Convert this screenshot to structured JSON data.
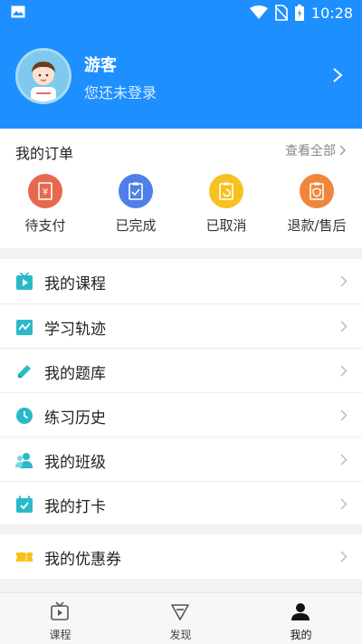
{
  "status_bar": {
    "time": "10:28"
  },
  "profile": {
    "name": "游客",
    "hint": "您还未登录"
  },
  "orders": {
    "title": "我的订单",
    "view_all": "查看全部",
    "items": [
      {
        "label": "待支付",
        "icon": "pending-payment-icon",
        "color": "#e8684e"
      },
      {
        "label": "已完成",
        "icon": "completed-icon",
        "color": "#4f7fe8"
      },
      {
        "label": "已取消",
        "icon": "cancelled-icon",
        "color": "#f7c21f"
      },
      {
        "label": "退款/售后",
        "icon": "refund-icon",
        "color": "#f0863c"
      }
    ]
  },
  "menu": [
    {
      "label": "我的课程",
      "icon": "course-play-icon"
    },
    {
      "label": "学习轨迹",
      "icon": "learning-track-icon"
    },
    {
      "label": "我的题库",
      "icon": "pencil-icon"
    },
    {
      "label": "练习历史",
      "icon": "clock-icon"
    },
    {
      "label": "我的班级",
      "icon": "class-people-icon"
    },
    {
      "label": "我的打卡",
      "icon": "checkin-calendar-icon"
    }
  ],
  "menu2": [
    {
      "label": "我的优惠券",
      "icon": "coupon-icon"
    }
  ],
  "tabs": [
    {
      "label": "课程",
      "icon": "tv-play-icon"
    },
    {
      "label": "发现",
      "icon": "discover-icon"
    },
    {
      "label": "我的",
      "icon": "user-icon",
      "active": true
    }
  ],
  "colors": {
    "brand": "#1e8fff",
    "teal": "#2bb9c9"
  }
}
